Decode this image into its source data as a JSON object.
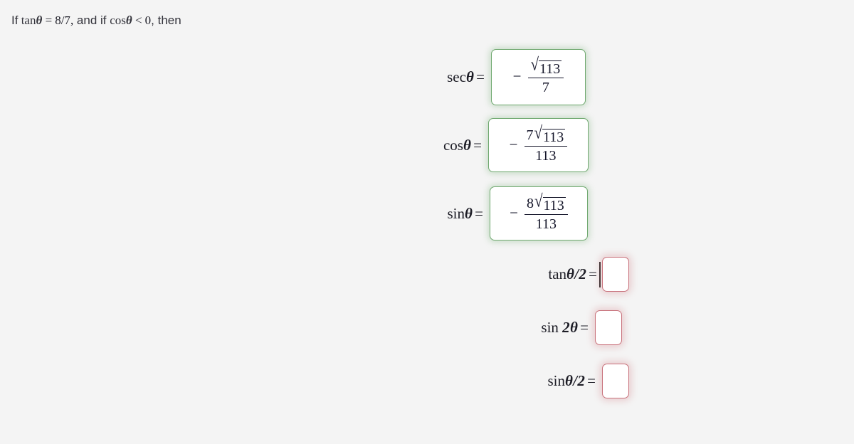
{
  "page": {
    "background_color": "#f4f4f4",
    "correct_border_color": "#6fa86f",
    "empty_border_color": "#c8717b",
    "text_color": "#2b2b33"
  },
  "prompt": {
    "lead": "If",
    "func": "tan",
    "variable": "θ",
    "equals": "=",
    "value": "8/7",
    "comma": ",",
    "mid": "and if",
    "func2": "cos",
    "variable2": "θ",
    "relation": "<",
    "value2": "0",
    "comma2": ",",
    "tail": "then"
  },
  "equations": [
    {
      "label_func": "sec",
      "label_var": "θ",
      "label_eq": "=",
      "status": "correct",
      "sign": "−",
      "numerator_coefficient": "",
      "radical_symbol": "√",
      "radicand": "113",
      "denominator": "7",
      "answer_text": "-sqrt(113)/7"
    },
    {
      "label_func": "cos",
      "label_var": "θ",
      "label_eq": "=",
      "status": "correct",
      "sign": "−",
      "numerator_coefficient": "7",
      "radical_symbol": "√",
      "radicand": "113",
      "denominator": "113",
      "answer_text": "-7sqrt(113)/113"
    },
    {
      "label_func": "sin",
      "label_var": "θ",
      "label_eq": "=",
      "status": "correct",
      "sign": "−",
      "numerator_coefficient": "8",
      "radical_symbol": "√",
      "radicand": "113",
      "denominator": "113",
      "answer_text": "-8sqrt(113)/113"
    }
  ],
  "inputs": [
    {
      "label_func": "tan",
      "label_var": "θ/2",
      "label_eq": "=",
      "status": "empty",
      "value": "",
      "focused": true
    },
    {
      "label_func": "sin",
      "label_var": "2θ",
      "label_eq": "=",
      "status": "empty",
      "value": "",
      "focused": false
    },
    {
      "label_func": "sin",
      "label_var": "θ/2",
      "label_eq": "=",
      "status": "empty",
      "value": "",
      "focused": false
    }
  ]
}
